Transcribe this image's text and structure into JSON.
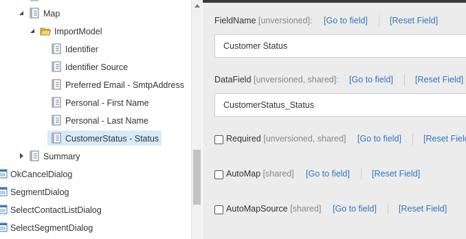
{
  "tree": {
    "items": [
      {
        "label": "Map",
        "icon": "template-icon"
      },
      {
        "label": "ImportModel",
        "icon": "folder-icon"
      },
      {
        "label": "Identifier",
        "icon": "template-icon"
      },
      {
        "label": "Identifier Source",
        "icon": "template-icon"
      },
      {
        "label": "Preferred Email - SmtpAddress",
        "icon": "template-icon"
      },
      {
        "label": "Personal - First Name",
        "icon": "template-icon"
      },
      {
        "label": "Personal - Last Name",
        "icon": "template-icon"
      },
      {
        "label": "CustomerStatus - Status",
        "icon": "template-icon",
        "selected": true
      },
      {
        "label": "Summary",
        "icon": "template-icon"
      },
      {
        "label": "OkCancelDialog",
        "icon": "dialog-icon"
      },
      {
        "label": "SegmentDialog",
        "icon": "dialog-icon"
      },
      {
        "label": "SelectContactListDialog",
        "icon": "dialog-icon"
      },
      {
        "label": "SelectSegmentDialog",
        "icon": "dialog-icon"
      }
    ]
  },
  "fields": {
    "field_name": {
      "label": "FieldName",
      "meta": "[unversioned]:",
      "go_to": "[Go to field]",
      "reset": "[Reset Field]",
      "value": "Customer Status"
    },
    "data_field": {
      "label": "DataField",
      "meta": "[unversioned, shared]:",
      "go_to": "[Go to field]",
      "reset": "[Reset Field]",
      "value": "CustomerStatus_Status"
    },
    "required": {
      "label": "Required",
      "meta": "[unversioned, shared]",
      "go_to": "[Go to field]",
      "reset": "[Reset Field]",
      "checked": false
    },
    "auto_map": {
      "label": "AutoMap",
      "meta": "[shared]",
      "go_to": "[Go to field]",
      "reset": "[Reset Field]",
      "checked": false
    },
    "auto_map_source": {
      "label": "AutoMapSource",
      "meta": "[shared]",
      "go_to": "[Go to field]",
      "reset": "[Reset Field]",
      "checked": false
    }
  },
  "colors": {
    "link": "#2e78c0",
    "selected_bg": "#d6ebf7",
    "content_bg": "#ececec"
  }
}
